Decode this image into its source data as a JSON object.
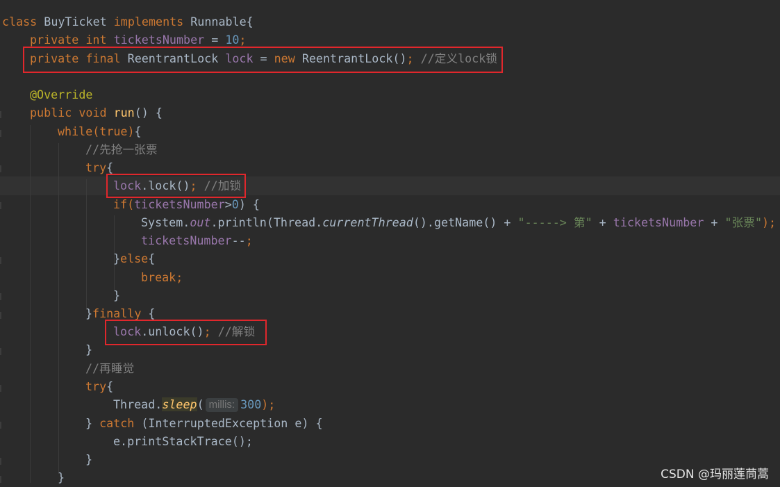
{
  "code": {
    "l1": {
      "kw1": "class",
      "name": " BuyTicket ",
      "kw2": "implements",
      "iface": " Runnable{"
    },
    "l2": {
      "kw": "private int ",
      "field": "ticketsNumber",
      "eq": " = ",
      "num": "10",
      "semi": ";"
    },
    "l3": {
      "kw1": "private final ",
      "type": "ReentrantLock ",
      "field": "lock",
      "eq": " = ",
      "kw2": "new ",
      "ctor": "ReentrantLock()",
      "semi": "; ",
      "comment": "//定义lock锁"
    },
    "l4": {
      "ann": "@Override"
    },
    "l5": {
      "kw": "public void ",
      "fn": "run",
      "rest": "() {"
    },
    "l6": {
      "kw": "while(true)",
      "rest": "{"
    },
    "l7": {
      "comment": "//先抢一张票"
    },
    "l8": {
      "kw": "try",
      "rest": "{"
    },
    "l9": {
      "field": "lock",
      "call": ".lock()",
      "semi": "; ",
      "comment": "//加锁"
    },
    "l10": {
      "kw": "if(",
      "field": "ticketsNumber",
      "cond": ">",
      "num": "0",
      "rest": ") {"
    },
    "l11": {
      "a": "System.",
      "out": "out",
      "b": ".println(Thread.",
      "ct": "currentThread",
      "c": "().getName() + ",
      "s1": "\"-----> 第\"",
      "d": " + ",
      "field": "ticketsNumber",
      "e": " + ",
      "s2": "\"张票\"",
      "end": ");"
    },
    "l12": {
      "field": "ticketsNumber",
      "op": "--",
      "semi": ";"
    },
    "l13": {
      "brace": "}",
      "kw": "else",
      "rest": "{"
    },
    "l14": {
      "kw": "break;"
    },
    "l15": {
      "brace": "}"
    },
    "l16": {
      "brace": "}",
      "kw": "finally",
      "rest": " {"
    },
    "l17": {
      "field": "lock",
      "call": ".unlock()",
      "semi": "; ",
      "comment": "//解锁"
    },
    "l18": {
      "brace": "}"
    },
    "l19": {
      "comment": "//再睡觉"
    },
    "l20": {
      "kw": "try",
      "rest": "{"
    },
    "l21": {
      "a": "Thread.",
      "sleep": "sleep",
      "open": "(",
      "hint": "millis:",
      "num": "300",
      "end": ");"
    },
    "l22": {
      "a": "} ",
      "kw": "catch",
      "rest": " (InterruptedException e) {"
    },
    "l23": {
      "text": "e.printStackTrace();"
    },
    "l24": {
      "brace": "}"
    },
    "l25": {
      "brace": "}"
    }
  },
  "watermark": "CSDN @玛丽莲茼蒿",
  "colors": {
    "background": "#2b2b2b",
    "keyword": "#cc7832",
    "field": "#9876aa",
    "number": "#6897bb",
    "annotation": "#bbb529",
    "comment": "#808080",
    "string": "#6a8759",
    "function": "#ffc66d",
    "text": "#a9b7c6",
    "highlight_box": "#e0272c"
  }
}
